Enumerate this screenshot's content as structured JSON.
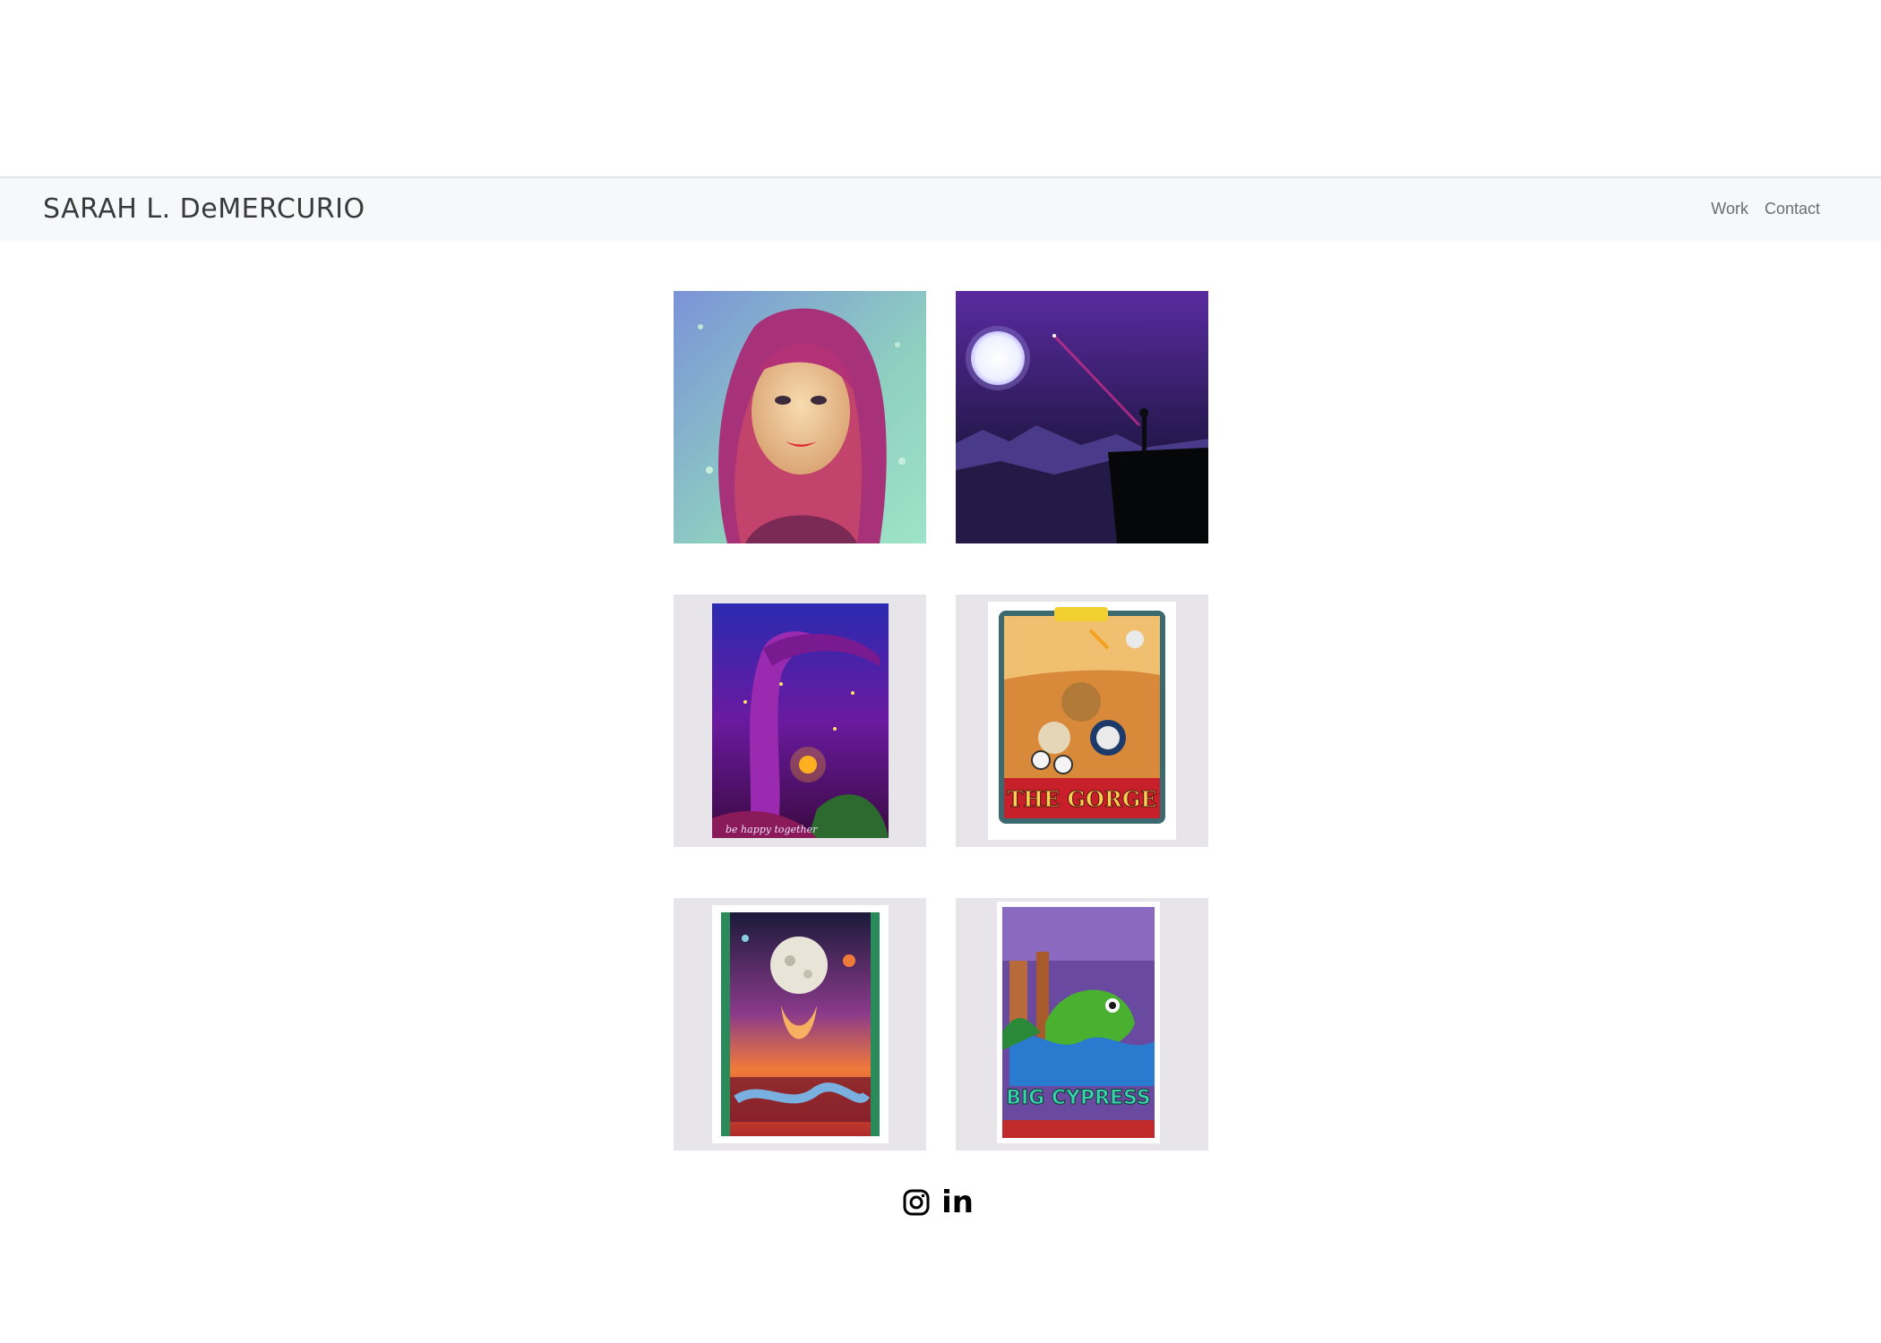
{
  "site": {
    "title": "SARAH L. DeMERCURIO"
  },
  "nav": {
    "items": [
      {
        "label": "Work"
      },
      {
        "label": "Contact"
      }
    ]
  },
  "gallery": {
    "tiles": [
      {
        "icon": "portrait-illustration-image"
      },
      {
        "icon": "moonlit-cliff-illustration-image"
      },
      {
        "icon": "enchanted-forest-poster-image",
        "caption": "be happy together"
      },
      {
        "icon": "the-gorge-poster-image",
        "caption": "THE GORGE"
      },
      {
        "icon": "full-moon-poster-image"
      },
      {
        "icon": "big-cypress-poster-image",
        "caption": "BIG CYPRESS"
      }
    ]
  },
  "social": {
    "instagram_icon": "instagram-icon",
    "linkedin_icon": "linkedin-icon",
    "linkedin_label": "in"
  },
  "colors": {
    "nav_bg": "#f7f8f9",
    "tile_bg": "#e8e5ea",
    "brand_text": "#3a3a3a"
  }
}
